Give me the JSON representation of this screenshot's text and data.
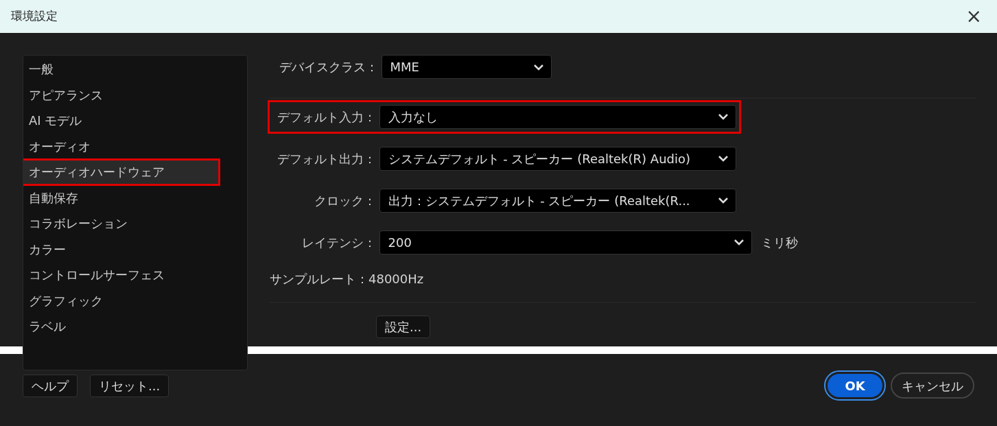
{
  "window": {
    "title": "環境設定",
    "close": "×"
  },
  "sidebar": {
    "items": [
      {
        "label": "一般",
        "selected": false,
        "highlighted": false
      },
      {
        "label": "アピアランス",
        "selected": false,
        "highlighted": false
      },
      {
        "label": "AI モデル",
        "selected": false,
        "highlighted": false
      },
      {
        "label": "オーディオ",
        "selected": false,
        "highlighted": false
      },
      {
        "label": "オーディオハードウェア",
        "selected": true,
        "highlighted": true
      },
      {
        "label": "自動保存",
        "selected": false,
        "highlighted": false
      },
      {
        "label": "コラボレーション",
        "selected": false,
        "highlighted": false
      },
      {
        "label": "カラー",
        "selected": false,
        "highlighted": false
      },
      {
        "label": "コントロールサーフェス",
        "selected": false,
        "highlighted": false
      },
      {
        "label": "グラフィック",
        "selected": false,
        "highlighted": false
      },
      {
        "label": "ラベル",
        "selected": false,
        "highlighted": false
      }
    ]
  },
  "device_class": {
    "label": "デバイスクラス：",
    "value": "MME"
  },
  "fields": [
    {
      "label": "デフォルト入力：",
      "value": "入力なし",
      "highlighted": true
    },
    {
      "label": "デフォルト出力：",
      "value": "システムデフォルト - スピーカー (Realtek(R) Audio)",
      "highlighted": false
    },
    {
      "label": "クロック：",
      "value": "出力：システムデフォルト - スピーカー (Realtek(R...",
      "highlighted": false
    },
    {
      "label": "レイテンシ：",
      "value": "200",
      "unit": "ミリ秒",
      "highlighted": false
    }
  ],
  "sample_rate": "サンプルレート：48000Hz",
  "settings_button": "設定...",
  "footer": {
    "left_buttons": [
      "ヘルプ",
      "リセット..."
    ],
    "ok": "OK",
    "cancel": "キャンセル"
  }
}
